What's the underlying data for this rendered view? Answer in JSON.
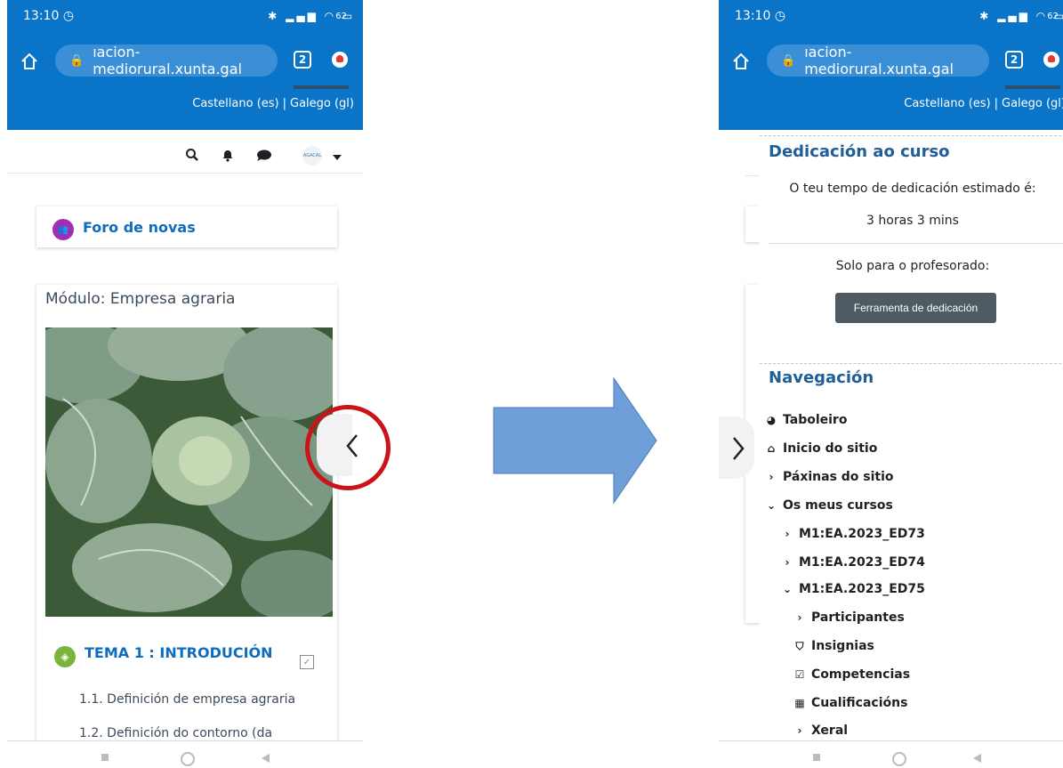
{
  "status_bar": {
    "time": "13:10",
    "alarm_icon": "alarm-icon",
    "battery": "62"
  },
  "browser": {
    "url": "ıacion-mediorural.xunta.gal",
    "tab_count": "2"
  },
  "lang": {
    "es": "Castellano (es)",
    "separator": "|",
    "gl": "Galego (gl)"
  },
  "left": {
    "forum_title": "Foro de novas",
    "module_title": "Módulo: Empresa agraria",
    "topic_title": "TEMA 1 : INTRODUCIÓN",
    "items": [
      "1.1. Definición de empresa agraria",
      "1.2. Definición do contorno (da"
    ],
    "avatar_text": "AGACAL"
  },
  "right": {
    "dedication_title": "Dedicación ao curso",
    "estimated_label": "O teu tempo de dedicación estimado é:",
    "estimated_value": "3 horas 3 mins",
    "teachers_only": "Solo para o profesorado:",
    "tool_button": "Ferramenta de dedicación",
    "nav_title": "Navegación",
    "nav_items": [
      {
        "label": "Taboleiro",
        "icon": "dashboard-icon"
      },
      {
        "label": "Inicio do sitio",
        "icon": "home-icon"
      },
      {
        "label": "Páxinas do sitio",
        "icon": "chevron-right-icon"
      },
      {
        "label": "Os meus cursos",
        "icon": "chevron-down-icon"
      },
      {
        "label": "M1:EA.2023_ED73",
        "icon": "chevron-right-icon"
      },
      {
        "label": "M1:EA.2023_ED74",
        "icon": "chevron-right-icon"
      },
      {
        "label": "M1:EA.2023_ED75",
        "icon": "chevron-down-icon"
      },
      {
        "label": "Participantes",
        "icon": "chevron-right-icon"
      },
      {
        "label": "Insignias",
        "icon": "shield-icon"
      },
      {
        "label": "Competencias",
        "icon": "check-square-icon"
      },
      {
        "label": "Cualificacións",
        "icon": "table-icon"
      },
      {
        "label": "Xeral",
        "icon": "chevron-right-icon"
      }
    ]
  },
  "colors": {
    "brand_blue": "#0a74c9",
    "link_blue": "#0f6cbf",
    "highlight_red": "#c9141a",
    "arrow_blue": "#6f9fd8"
  }
}
